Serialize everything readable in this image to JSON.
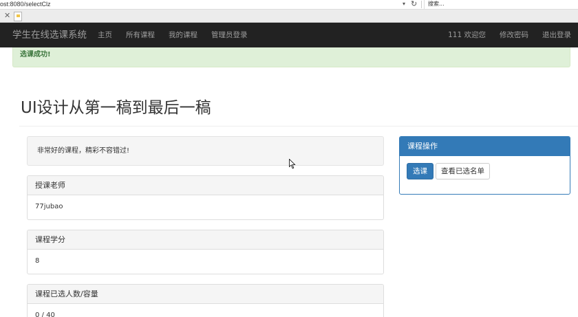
{
  "browser": {
    "url": "ost:8080/selectClz",
    "search_placeholder": "搜索..."
  },
  "navbar": {
    "brand": "学生在线选课系统",
    "links": [
      "主页",
      "所有课程",
      "我的课程",
      "管理员登录"
    ],
    "right_links": [
      "111 欢迎您",
      "修改密码",
      "退出登录"
    ]
  },
  "alert": {
    "message": "选课成功!"
  },
  "course": {
    "title": "UI设计从第一稿到最后一稿",
    "description": "非常好的课程，精彩不容错过!",
    "panels": [
      {
        "heading": "授课老师",
        "value": "77jubao"
      },
      {
        "heading": "课程学分",
        "value": "8"
      },
      {
        "heading": "课程已选人数/容量",
        "value": "0 / 40"
      }
    ]
  },
  "operations": {
    "heading": "课程操作",
    "select_label": "选课",
    "view_selected_label": "查看已选名单"
  },
  "colors": {
    "navbar_bg": "#222222",
    "primary": "#337ab7",
    "success_bg": "#dff0d8",
    "success_text": "#3c763d"
  }
}
